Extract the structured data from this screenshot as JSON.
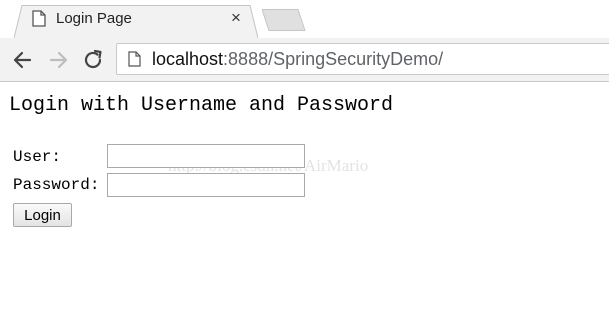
{
  "tab": {
    "title": "Login Page",
    "close_glyph": "×",
    "icon": "document-icon"
  },
  "toolbar": {
    "url_host": "localhost",
    "url_rest": ":8888/SpringSecurityDemo/",
    "icons": [
      "back-arrow-icon",
      "forward-arrow-icon",
      "reload-icon",
      "page-info-icon"
    ]
  },
  "page": {
    "heading": "Login with Username and Password",
    "username_label": "User:",
    "password_label": "Password:",
    "username_value": "",
    "password_value": "",
    "login_button": "Login",
    "watermark": "http://blog.csdn.net/AirMario"
  },
  "colors": {
    "tab_bg": "#f2f2f2",
    "toolbar_bg": "#f2f2f2",
    "url_host": "#111111",
    "url_rest": "#5f6368",
    "watermark": "#e3e3e3"
  }
}
